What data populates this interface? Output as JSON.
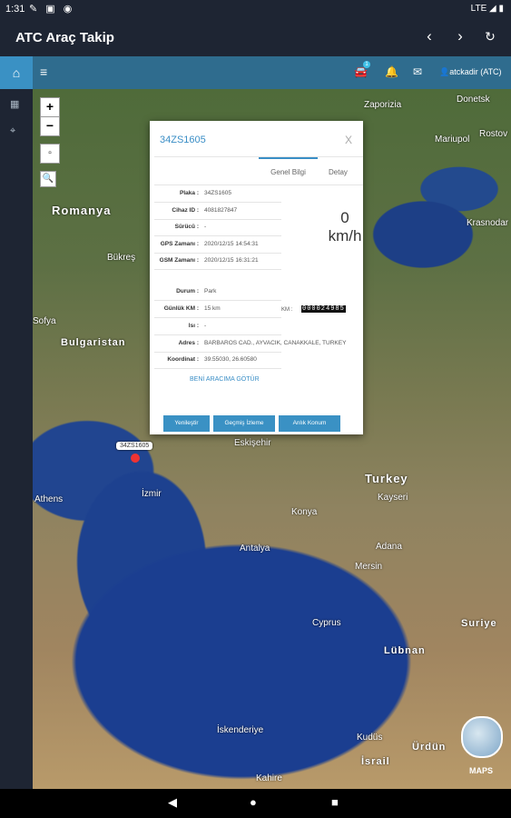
{
  "status_bar": {
    "time": "1:31",
    "network": "LTE"
  },
  "app_bar": {
    "title": "ATC Araç Takip"
  },
  "top_nav": {
    "user": "atckadir (ATC)",
    "badge_count": "1"
  },
  "map": {
    "zoom_in": "+",
    "zoom_out": "−",
    "labels": {
      "romanya": "Romanya",
      "bulgaristan": "Bulgaristan",
      "turkey": "Turkey",
      "suriye": "Suriye",
      "lubnan": "Lübnan",
      "ordun": "Ürdün",
      "israil": "İsrail",
      "athens": "Athens",
      "izmir": "İzmir",
      "eskisehir": "Eskişehir",
      "konya": "Konya",
      "antalya": "Antalya",
      "mersin": "Mersin",
      "adana": "Adana",
      "kayseri": "Kayseri",
      "sofya": "Sofya",
      "bukres": "Bükreş",
      "donetsk": "Donetsk",
      "zaporizia": "Zaporizia",
      "mariupol": "Mariupol",
      "krasnodar": "Krasnodar",
      "rostov": "Rostov",
      "kibris": "Cyprus",
      "kahire": "Kahire",
      "iskenderiye": "İskenderiye",
      "kudus": "Kudüs"
    },
    "marker_label": "34ZS1605",
    "brand": "MAPS"
  },
  "dialog": {
    "title": "34ZS1605",
    "close": "X",
    "tabs": {
      "general": "Genel Bilgi",
      "detail": "Detay"
    },
    "fields": [
      {
        "key": "Plaka :",
        "value": "34ZS1605"
      },
      {
        "key": "Cihaz ID :",
        "value": "4081827847"
      },
      {
        "key": "Sürücü :",
        "value": "-"
      },
      {
        "key": "GPS Zamanı :",
        "value": "2020/12/15 14:54:31"
      },
      {
        "key": "GSM Zamanı :",
        "value": "2020/12/15 16:31:21"
      },
      {
        "key": "Durum :",
        "value": "Park"
      },
      {
        "key": "Günlük KM :",
        "value": "15 km"
      },
      {
        "key": "Isı :",
        "value": "-"
      },
      {
        "key": "Adres :",
        "value": "BARBAROS CAD., AYVACIK, CANAKKALE, TURKEY"
      },
      {
        "key": "Koordinat :",
        "value": "39.55030, 26.60580"
      }
    ],
    "speed_value": "0",
    "speed_unit": "km/h",
    "km_label": "KM :",
    "km_value": "000024985",
    "link": "BENİ ARACIMA GÖTÜR",
    "buttons": {
      "refresh": "Yenileştir",
      "history": "Geçmiş İzleme",
      "live": "Anlık Konum"
    }
  }
}
